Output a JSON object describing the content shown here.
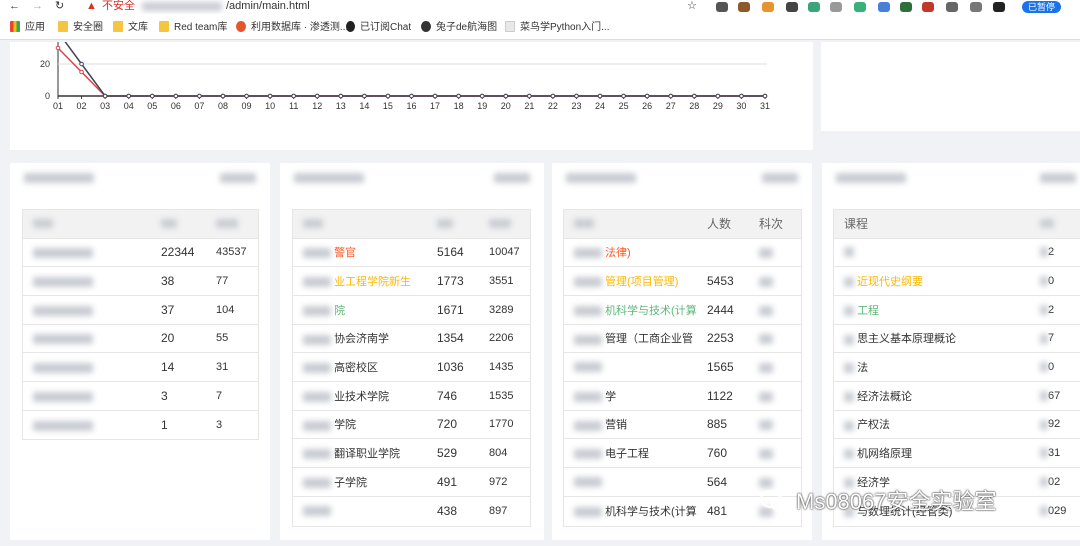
{
  "browser": {
    "security_label": "不安全",
    "url_path": "/admin/main.html",
    "paused_label": "已暂停",
    "bookmarks": [
      {
        "label": "应用",
        "icon": "apps-grid-icon"
      },
      {
        "label": "安全圈",
        "icon": "folder-icon"
      },
      {
        "label": "文库",
        "icon": "folder-icon"
      },
      {
        "label": "Red team库",
        "icon": "folder-icon"
      },
      {
        "label": "利用数据库 · 渗透测...",
        "icon": "site-icon"
      },
      {
        "label": "已订阅Chat",
        "icon": "g-icon"
      },
      {
        "label": "兔子de航海图",
        "icon": "site-icon"
      },
      {
        "label": "菜鸟学Python入门...",
        "icon": "page-icon"
      }
    ]
  },
  "chart_data": {
    "type": "line",
    "x": [
      "01",
      "02",
      "03",
      "04",
      "05",
      "06",
      "07",
      "08",
      "09",
      "10",
      "11",
      "12",
      "13",
      "14",
      "15",
      "16",
      "17",
      "18",
      "19",
      "20",
      "21",
      "22",
      "23",
      "24",
      "25",
      "26",
      "27",
      "28",
      "29",
      "30",
      "31"
    ],
    "yticks": [
      0,
      20
    ],
    "series": [
      {
        "color": "#e04141",
        "values": [
          30,
          15,
          0
        ]
      },
      {
        "color": "#3f4658",
        "values": [
          40,
          20,
          0
        ]
      }
    ]
  },
  "cards": [
    {
      "headers": [
        "",
        "",
        ""
      ],
      "rows": [
        {
          "name": "",
          "a": "22344",
          "b": "43537"
        },
        {
          "name": "",
          "a": "38",
          "b": "77"
        },
        {
          "name": "",
          "a": "37",
          "b": "104"
        },
        {
          "name": "",
          "a": "20",
          "b": "55"
        },
        {
          "name": "",
          "a": "14",
          "b": "31"
        },
        {
          "name": "",
          "a": "3",
          "b": "7"
        },
        {
          "name": "",
          "a": "1",
          "b": "3"
        }
      ]
    },
    {
      "headers": [
        "",
        "",
        ""
      ],
      "rows": [
        {
          "name": "警官",
          "a": "5164",
          "b": "10047"
        },
        {
          "name": "业工程学院新生",
          "a": "1773",
          "b": "3551"
        },
        {
          "name": "院",
          "a": "1671",
          "b": "3289"
        },
        {
          "name": "协会济南学",
          "a": "1354",
          "b": "2206"
        },
        {
          "name": "高密校区",
          "a": "1036",
          "b": "1435"
        },
        {
          "name": "业技术学院",
          "a": "746",
          "b": "1535"
        },
        {
          "name": "学院",
          "a": "720",
          "b": "1770"
        },
        {
          "name": "翻译职业学院",
          "a": "529",
          "b": "804"
        },
        {
          "name": "子学院",
          "a": "491",
          "b": "972"
        },
        {
          "name": "",
          "a": "438",
          "b": "897"
        }
      ]
    },
    {
      "headers": [
        "",
        "人数",
        "科次"
      ],
      "rows": [
        {
          "name": "法律)",
          "a": "",
          "b": ""
        },
        {
          "name": "管理(项目管理)",
          "a": "5453",
          "b": ""
        },
        {
          "name": "机科学与技术(计算",
          "a": "2444",
          "b": ""
        },
        {
          "name": "管理（工商企业管",
          "a": "2253",
          "b": ""
        },
        {
          "name": "",
          "a": "1565",
          "b": ""
        },
        {
          "name": "学",
          "a": "1122",
          "b": ""
        },
        {
          "name": "营销",
          "a": "885",
          "b": ""
        },
        {
          "name": "电子工程",
          "a": "760",
          "b": ""
        },
        {
          "name": "",
          "a": "564",
          "b": ""
        },
        {
          "name": "机科学与技术(计算",
          "a": "481",
          "b": ""
        }
      ]
    },
    {
      "headers": [
        "课程",
        ""
      ],
      "rows": [
        {
          "name": "",
          "a": "2"
        },
        {
          "name": "近现代史纲要",
          "a": "0"
        },
        {
          "name": "工程",
          "a": "2"
        },
        {
          "name": "思主义基本原理概论",
          "a": "7"
        },
        {
          "name": "法",
          "a": "0"
        },
        {
          "name": "经济法概论",
          "a": "67"
        },
        {
          "name": "产权法",
          "a": "92"
        },
        {
          "name": "机网络原理",
          "a": "31"
        },
        {
          "name": "经济学",
          "a": "02"
        },
        {
          "name": "与数理统计(经管类)",
          "a": "029"
        }
      ]
    }
  ],
  "watermark": "Ms08067安全实验室"
}
